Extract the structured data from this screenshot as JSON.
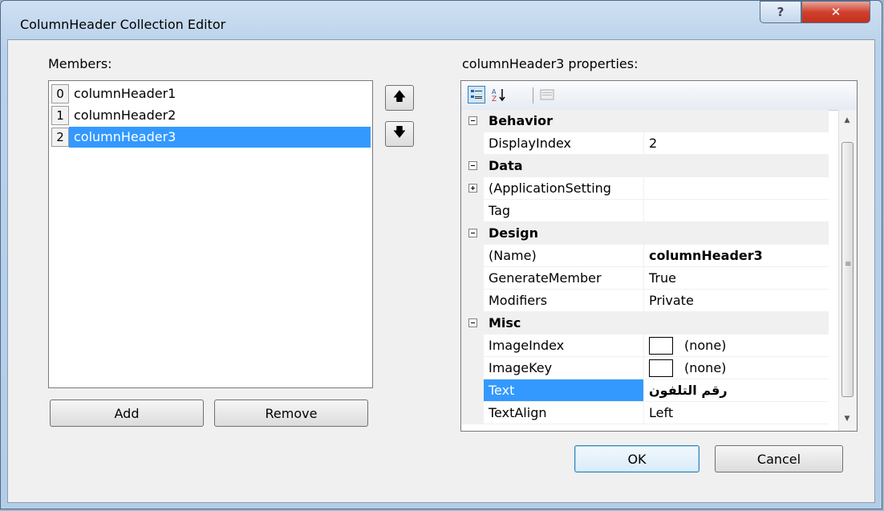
{
  "window": {
    "title": "ColumnHeader Collection Editor",
    "help_label": "?",
    "close_label": "✕"
  },
  "members": {
    "label": "Members:",
    "items": [
      {
        "index": "0",
        "name": "columnHeader1",
        "selected": false
      },
      {
        "index": "1",
        "name": "columnHeader2",
        "selected": false
      },
      {
        "index": "2",
        "name": "columnHeader3",
        "selected": true
      }
    ],
    "move_up": "🡅",
    "move_down": "🡇",
    "add_label": "Add",
    "remove_label": "Remove"
  },
  "properties": {
    "label": "columnHeader3 properties:",
    "categories": [
      {
        "name": "Behavior",
        "rows": [
          {
            "name": "DisplayIndex",
            "value": "2"
          }
        ]
      },
      {
        "name": "Data",
        "rows": [
          {
            "name": "(ApplicationSetting",
            "value": "",
            "expandable": true
          },
          {
            "name": "Tag",
            "value": ""
          }
        ]
      },
      {
        "name": "Design",
        "rows": [
          {
            "name": "(Name)",
            "value": "columnHeader3",
            "bold": true
          },
          {
            "name": "GenerateMember",
            "value": "True"
          },
          {
            "name": "Modifiers",
            "value": "Private"
          }
        ]
      },
      {
        "name": "Misc",
        "rows": [
          {
            "name": "ImageIndex",
            "value": "(none)",
            "swatch": true
          },
          {
            "name": "ImageKey",
            "value": "(none)",
            "swatch": true
          },
          {
            "name": "Text",
            "value": "رقم التلفون",
            "selected": true,
            "bold": true
          },
          {
            "name": "TextAlign",
            "value": "Left"
          }
        ]
      }
    ]
  },
  "footer": {
    "ok_label": "OK",
    "cancel_label": "Cancel"
  },
  "icons": {
    "categorized": "categorized-icon",
    "alphabetical": "alphabetical-icon",
    "property_pages": "property-pages-icon"
  },
  "colors": {
    "selection": "#3399ff",
    "titlebar": "#b9d1ea",
    "close_button": "#c3301e"
  }
}
